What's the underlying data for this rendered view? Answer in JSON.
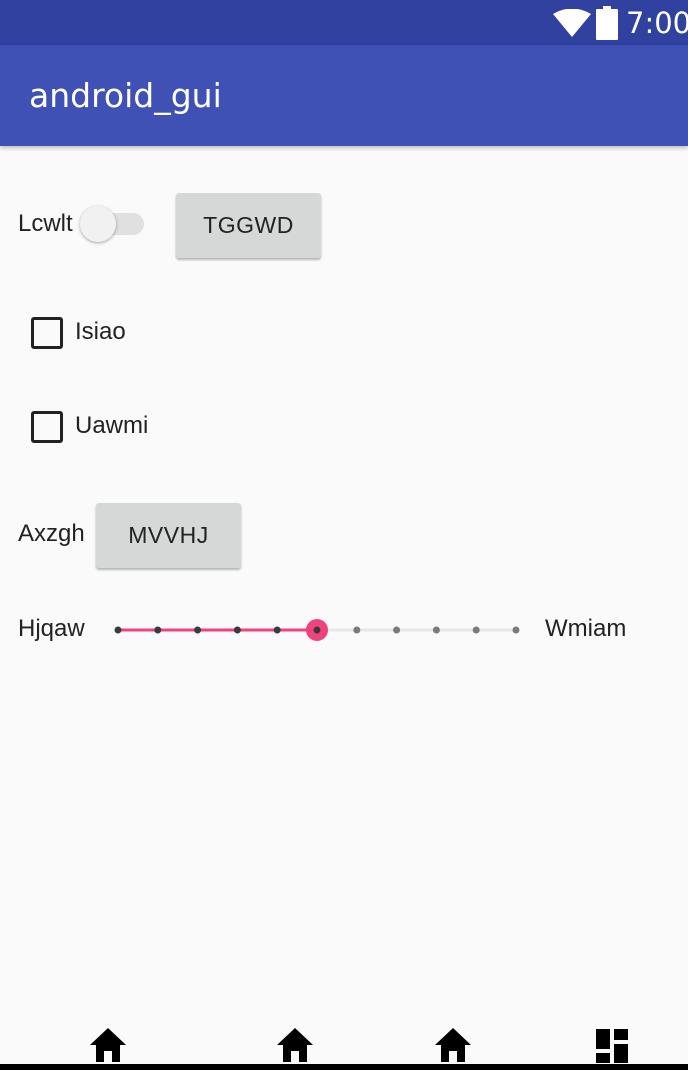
{
  "status_bar": {
    "time": "7:00",
    "icons": [
      "wifi-icon",
      "battery-icon"
    ],
    "color": "#3041a0"
  },
  "app_bar": {
    "title": "android_gui",
    "color": "#3f51b5"
  },
  "row1": {
    "switch_label": "Lcwlt",
    "switch_on": false,
    "button_label": "TGGWD"
  },
  "checkboxes": [
    {
      "label": "Isiao",
      "checked": false
    },
    {
      "label": "Uawmi",
      "checked": false
    }
  ],
  "row2": {
    "label": "Axzgh",
    "button_label": "MVVHJ"
  },
  "slider": {
    "left_label": "Hjqaw",
    "right_label": "Wmiam",
    "min": 0,
    "max": 10,
    "value": 5,
    "accent_color": "#f0437d"
  },
  "bottom_nav": {
    "items": [
      "home-icon",
      "home-icon",
      "home-icon",
      "dashboard-icon"
    ]
  }
}
